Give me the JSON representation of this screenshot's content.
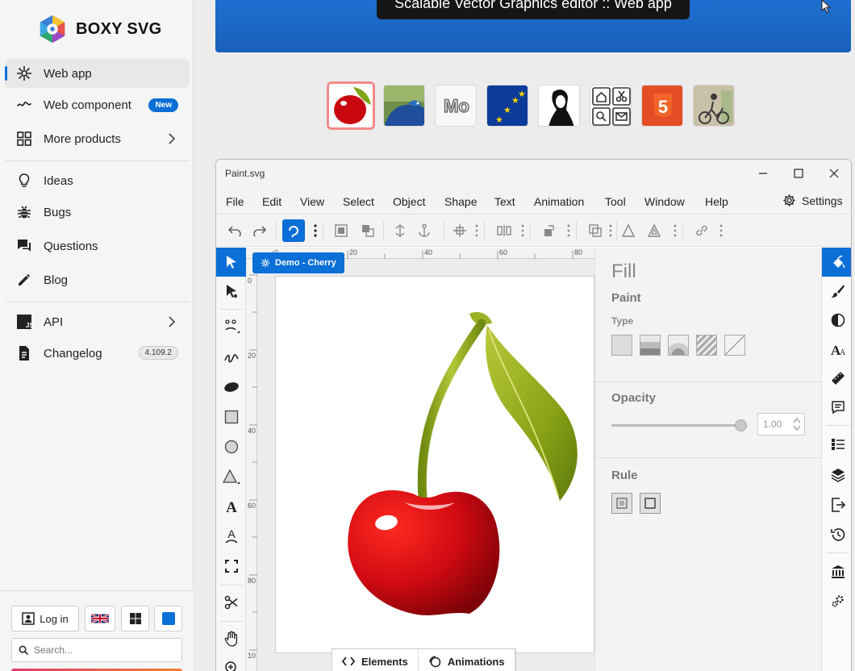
{
  "brand": {
    "name": "BOXY SVG"
  },
  "sidebar": {
    "items": [
      {
        "label": "Web app",
        "icon": "snowflake-icon"
      },
      {
        "label": "Web component",
        "icon": "component-icon",
        "badge": "New"
      },
      {
        "label": "More products",
        "icon": "grid-icon"
      },
      {
        "label": "Ideas",
        "icon": "lightbulb-icon"
      },
      {
        "label": "Bugs",
        "icon": "bug-icon"
      },
      {
        "label": "Questions",
        "icon": "chat-icon"
      },
      {
        "label": "Blog",
        "icon": "pencil-icon"
      },
      {
        "label": "API",
        "icon": "js-icon"
      },
      {
        "label": "Changelog",
        "icon": "document-icon",
        "badge": "4.109.2"
      }
    ],
    "login_label": "Log in",
    "search_placeholder": "Search..."
  },
  "banner": {
    "text": "Scalable Vector Graphics editor :: Web app"
  },
  "app": {
    "title": "Paint.svg",
    "menus": [
      "File",
      "Edit",
      "View",
      "Select",
      "Object",
      "Shape",
      "Text",
      "Animation",
      "Tool",
      "Window",
      "Help"
    ],
    "settings_label": "Settings",
    "demo_tab": "Demo - Cherry",
    "bottom_tabs": [
      "Elements",
      "Animations"
    ],
    "ruler_top": [
      "0",
      "20",
      "40",
      "60",
      "80"
    ],
    "ruler_left": [
      "0",
      "20",
      "40",
      "60",
      "80",
      "10"
    ],
    "panel": {
      "title": "Fill",
      "paint_heading": "Paint",
      "type_label": "Type",
      "opacity_heading": "Opacity",
      "opacity_value": "1.00",
      "opacity_fraction": 1.0,
      "rule_heading": "Rule"
    }
  },
  "colors": {
    "accent": "#0a6fd6",
    "cherry": "#d10a12",
    "leaf": "#7a9a10"
  }
}
